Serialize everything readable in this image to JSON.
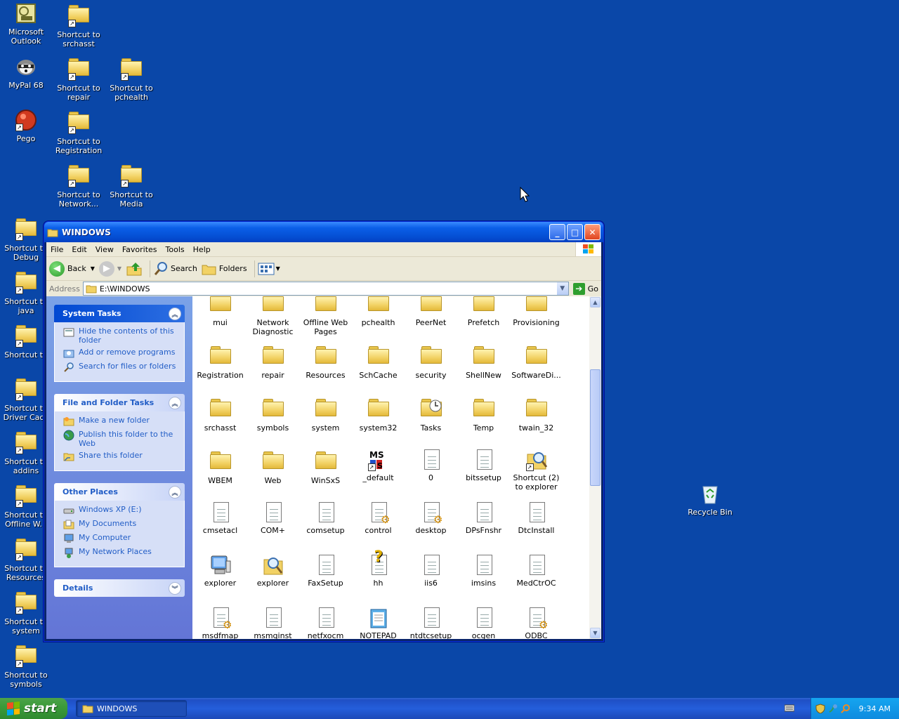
{
  "desktop": {
    "icons": [
      {
        "label": "Microsoft Outlook",
        "icon": "outlook-icon"
      },
      {
        "label": "Shortcut to srchasst",
        "icon": "folder-shortcut-icon"
      },
      {
        "label": "MyPal 68",
        "icon": "mypal-icon"
      },
      {
        "label": "Shortcut to repair",
        "icon": "folder-shortcut-icon"
      },
      {
        "label": "Shortcut to pchealth",
        "icon": "folder-shortcut-icon"
      },
      {
        "label": "Pego",
        "icon": "pego-icon"
      },
      {
        "label": "Shortcut to Registration",
        "icon": "folder-shortcut-icon"
      },
      {
        "label": "Shortcut to Network...",
        "icon": "folder-shortcut-icon"
      },
      {
        "label": "Shortcut to Media",
        "icon": "folder-shortcut-icon"
      },
      {
        "label": "Shortcut to Debug",
        "icon": "folder-shortcut-icon"
      },
      {
        "label": "Shortcut to java",
        "icon": "folder-shortcut-icon"
      },
      {
        "label": "Shortcut to",
        "icon": "folder-shortcut-icon"
      },
      {
        "label": "Shortcut to Driver Cach",
        "icon": "folder-shortcut-icon"
      },
      {
        "label": "Shortcut to addins",
        "icon": "folder-shortcut-icon"
      },
      {
        "label": "Shortcut to Offline W...",
        "icon": "offline-web-shortcut-icon"
      },
      {
        "label": "Shortcut to Resources",
        "icon": "folder-shortcut-icon"
      },
      {
        "label": "Shortcut to system",
        "icon": "folder-shortcut-icon"
      },
      {
        "label": "Shortcut to symbols",
        "icon": "folder-shortcut-icon"
      },
      {
        "label": "Recycle Bin",
        "icon": "recycle-bin-icon"
      }
    ]
  },
  "window": {
    "title": "WINDOWS",
    "menu": [
      "File",
      "Edit",
      "View",
      "Favorites",
      "Tools",
      "Help"
    ],
    "toolbar": {
      "back": "Back",
      "search": "Search",
      "folders": "Folders"
    },
    "address": {
      "label": "Address",
      "value": "E:\\WINDOWS",
      "go": "Go"
    }
  },
  "left_pane": {
    "system_tasks": {
      "title": "System Tasks",
      "items": [
        "Hide the contents of this folder",
        "Add or remove programs",
        "Search for files or folders"
      ]
    },
    "file_folder_tasks": {
      "title": "File and Folder Tasks",
      "items": [
        "Make a new folder",
        "Publish this folder to the Web",
        "Share this folder"
      ]
    },
    "other_places": {
      "title": "Other Places",
      "items": [
        "Windows XP (E:)",
        "My Documents",
        "My Computer",
        "My Network Places"
      ]
    },
    "details": {
      "title": "Details"
    }
  },
  "files": [
    {
      "label": "mui",
      "type": "folder"
    },
    {
      "label": "Network Diagnostic",
      "type": "folder"
    },
    {
      "label": "Offline Web Pages",
      "type": "folder"
    },
    {
      "label": "pchealth",
      "type": "folder"
    },
    {
      "label": "PeerNet",
      "type": "folder"
    },
    {
      "label": "Prefetch",
      "type": "folder"
    },
    {
      "label": "Provisioning",
      "type": "folder"
    },
    {
      "label": "Registration",
      "type": "folder"
    },
    {
      "label": "repair",
      "type": "folder"
    },
    {
      "label": "Resources",
      "type": "folder"
    },
    {
      "label": "SchCache",
      "type": "folder"
    },
    {
      "label": "security",
      "type": "folder"
    },
    {
      "label": "ShellNew",
      "type": "folder"
    },
    {
      "label": "SoftwareDi...",
      "type": "folder"
    },
    {
      "label": "srchasst",
      "type": "folder"
    },
    {
      "label": "symbols",
      "type": "folder"
    },
    {
      "label": "system",
      "type": "folder"
    },
    {
      "label": "system32",
      "type": "folder"
    },
    {
      "label": "Tasks",
      "type": "tasks"
    },
    {
      "label": "Temp",
      "type": "folder"
    },
    {
      "label": "twain_32",
      "type": "folder"
    },
    {
      "label": "WBEM",
      "type": "folder"
    },
    {
      "label": "Web",
      "type": "folder"
    },
    {
      "label": "WinSxS",
      "type": "folder"
    },
    {
      "label": "_default",
      "type": "msn"
    },
    {
      "label": "0",
      "type": "doc"
    },
    {
      "label": "bitssetup",
      "type": "doc"
    },
    {
      "label": "Shortcut (2) to explorer",
      "type": "search-shortcut"
    },
    {
      "label": "cmsetacl",
      "type": "doc"
    },
    {
      "label": "COM+",
      "type": "doc"
    },
    {
      "label": "comsetup",
      "type": "doc"
    },
    {
      "label": "control",
      "type": "gear"
    },
    {
      "label": "desktop",
      "type": "gear"
    },
    {
      "label": "DPsFnshr",
      "type": "doc"
    },
    {
      "label": "DtcInstall",
      "type": "doc"
    },
    {
      "label": "explorer",
      "type": "computer"
    },
    {
      "label": "explorer",
      "type": "search"
    },
    {
      "label": "FaxSetup",
      "type": "doc"
    },
    {
      "label": "hh",
      "type": "help"
    },
    {
      "label": "iis6",
      "type": "doc"
    },
    {
      "label": "imsins",
      "type": "doc"
    },
    {
      "label": "MedCtrOC",
      "type": "doc"
    },
    {
      "label": "msdfmap",
      "type": "gear"
    },
    {
      "label": "msmqinst",
      "type": "doc"
    },
    {
      "label": "netfxocm",
      "type": "doc"
    },
    {
      "label": "NOTEPAD",
      "type": "notepad"
    },
    {
      "label": "ntdtcsetup",
      "type": "doc"
    },
    {
      "label": "ocgen",
      "type": "doc"
    },
    {
      "label": "ODBC",
      "type": "gear"
    }
  ],
  "taskbar": {
    "start": "start",
    "task": "WINDOWS",
    "clock": "9:34 AM"
  }
}
